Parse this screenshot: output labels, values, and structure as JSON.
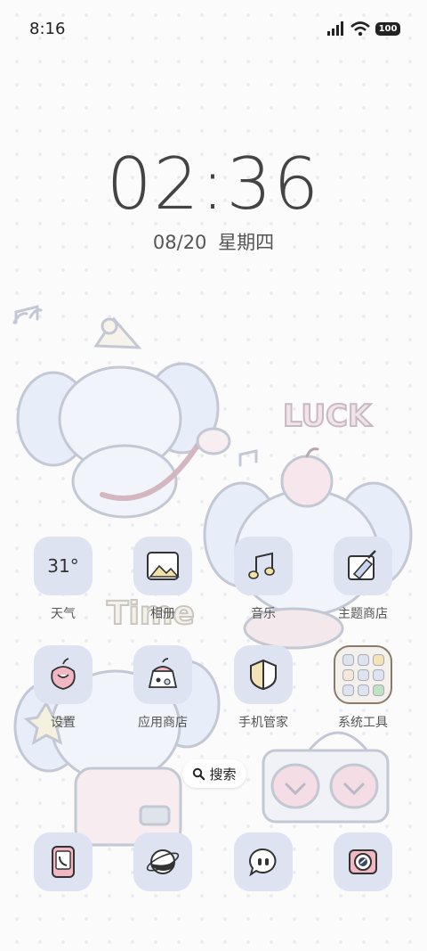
{
  "status_bar": {
    "time": "8:16",
    "battery": "100"
  },
  "lockclock": {
    "time": "02:36",
    "date": "08/20",
    "weekday": "星期四"
  },
  "wallpaper": {
    "luck_text": "LUCK",
    "time_text": "Time"
  },
  "apps_row1": [
    {
      "label": "天气",
      "value": "31°",
      "icon": "weather-icon"
    },
    {
      "label": "相册",
      "icon": "photo-album-icon"
    },
    {
      "label": "音乐",
      "icon": "music-note-icon"
    },
    {
      "label": "主题商店",
      "icon": "theme-brush-icon"
    }
  ],
  "apps_row2": [
    {
      "label": "设置",
      "icon": "settings-apple-icon"
    },
    {
      "label": "应用商店",
      "icon": "app-store-pudding-icon"
    },
    {
      "label": "手机管家",
      "icon": "shield-icon"
    },
    {
      "label": "系统工具",
      "icon": "folder-icon"
    }
  ],
  "search": {
    "label": "搜索"
  },
  "dock": [
    {
      "icon": "phone-icon"
    },
    {
      "icon": "browser-planet-icon"
    },
    {
      "icon": "messages-bubble-icon"
    },
    {
      "icon": "camera-icon"
    }
  ],
  "colors": {
    "tile": "#dde3f1",
    "accent_pink": "#f0b8c4",
    "accent_blue": "#c9d7f0"
  }
}
